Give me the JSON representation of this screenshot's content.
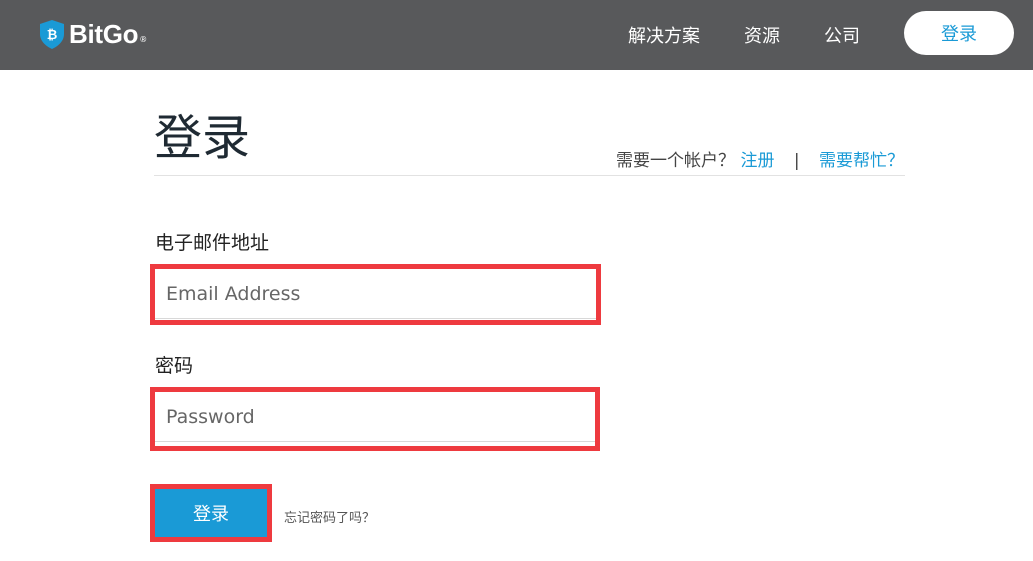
{
  "colors": {
    "header_bg": "#58595b",
    "accent": "#1a9ad6",
    "highlight": "#ee3a3f",
    "title_text": "#1f2a33"
  },
  "header": {
    "logo_text": "BitGo",
    "logo_registered": "®",
    "logo_icon": "shield-bitcoin-icon",
    "nav": {
      "solutions": "解决方案",
      "resources": "资源",
      "company": "公司",
      "login": "登录"
    }
  },
  "main": {
    "title": "登录",
    "account_prompt": "需要一个帐户？",
    "register_link": "注册",
    "separator": "|",
    "help_link": "需要帮忙？"
  },
  "form": {
    "email_label": "电子邮件地址",
    "email_placeholder": "Email Address",
    "email_value": "",
    "password_label": "密码",
    "password_placeholder": "Password",
    "password_value": "",
    "submit_label": "登录",
    "forgot_link": "忘记密码了吗？"
  }
}
